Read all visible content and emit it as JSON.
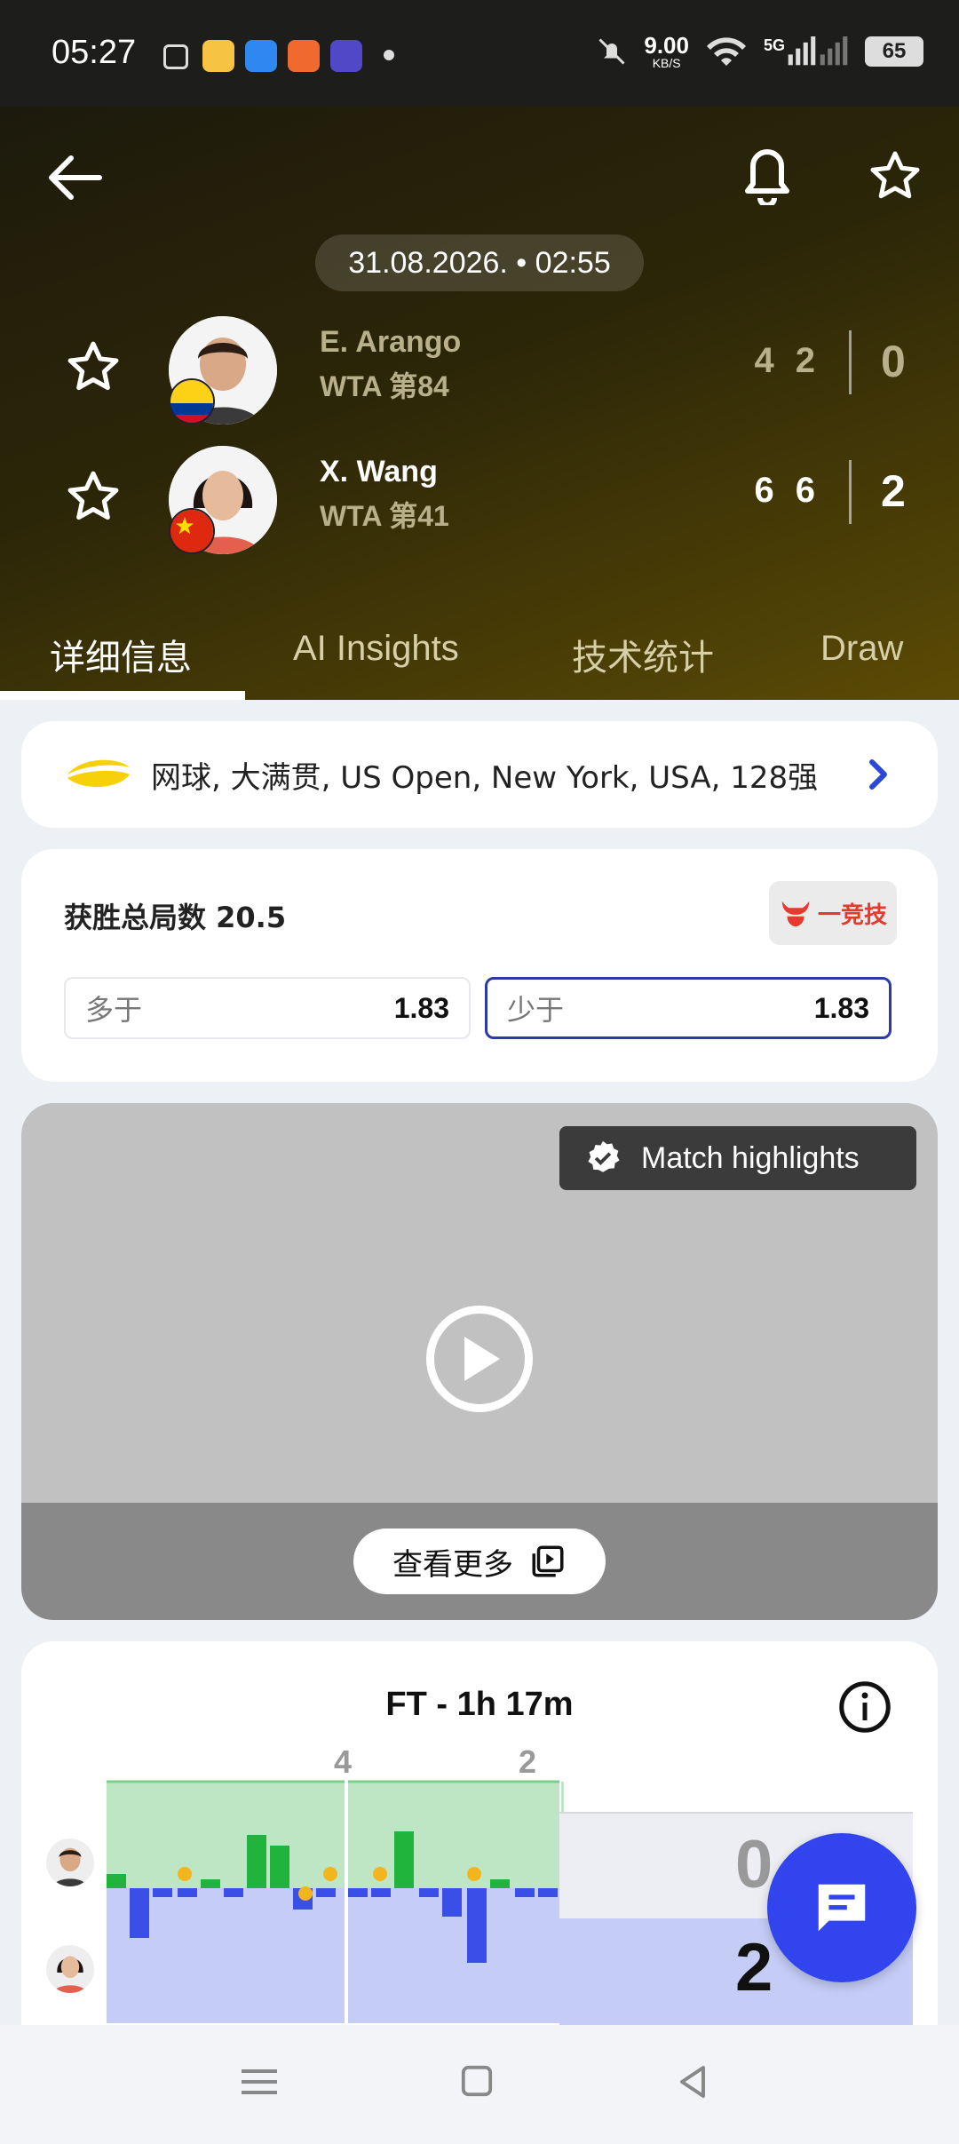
{
  "status_bar": {
    "time": "05:27",
    "net_speed_value": "9.00",
    "net_speed_unit": "KB/S",
    "network": "5G",
    "battery": "65"
  },
  "header": {
    "datetime": "31.08.2026. • 02:55",
    "players": [
      {
        "name": "E. Arango",
        "rank": "WTA 第84",
        "sets": [
          "4",
          "2"
        ],
        "total": "0",
        "winner": false
      },
      {
        "name": "X. Wang",
        "rank": "WTA 第41",
        "sets": [
          "6",
          "6"
        ],
        "total": "2",
        "winner": true
      }
    ],
    "tabs": [
      "详细信息",
      "AI Insights",
      "技术统计",
      "Draw"
    ]
  },
  "tournament": {
    "text": "网球, 大满贯, US Open, New York, USA, 128强"
  },
  "odds": {
    "title": "获胜总局数 20.5",
    "brand": "一竞技",
    "options": [
      {
        "label": "多于",
        "value": "1.83",
        "selected": false
      },
      {
        "label": "少于",
        "value": "1.83",
        "selected": true
      }
    ]
  },
  "video": {
    "badge": "Match highlights",
    "see_more": "查看更多"
  },
  "momentum": {
    "title": "FT - 1h 17m",
    "set_labels": [
      "4",
      "2"
    ],
    "score_top": "0",
    "score_bottom": "2",
    "colors": {
      "player1": "#20b43c",
      "player2": "#3a4fe8",
      "set_won_bg_p1": "#bfe6c4",
      "set_won_bg_p2": "#c5cdf6"
    }
  }
}
